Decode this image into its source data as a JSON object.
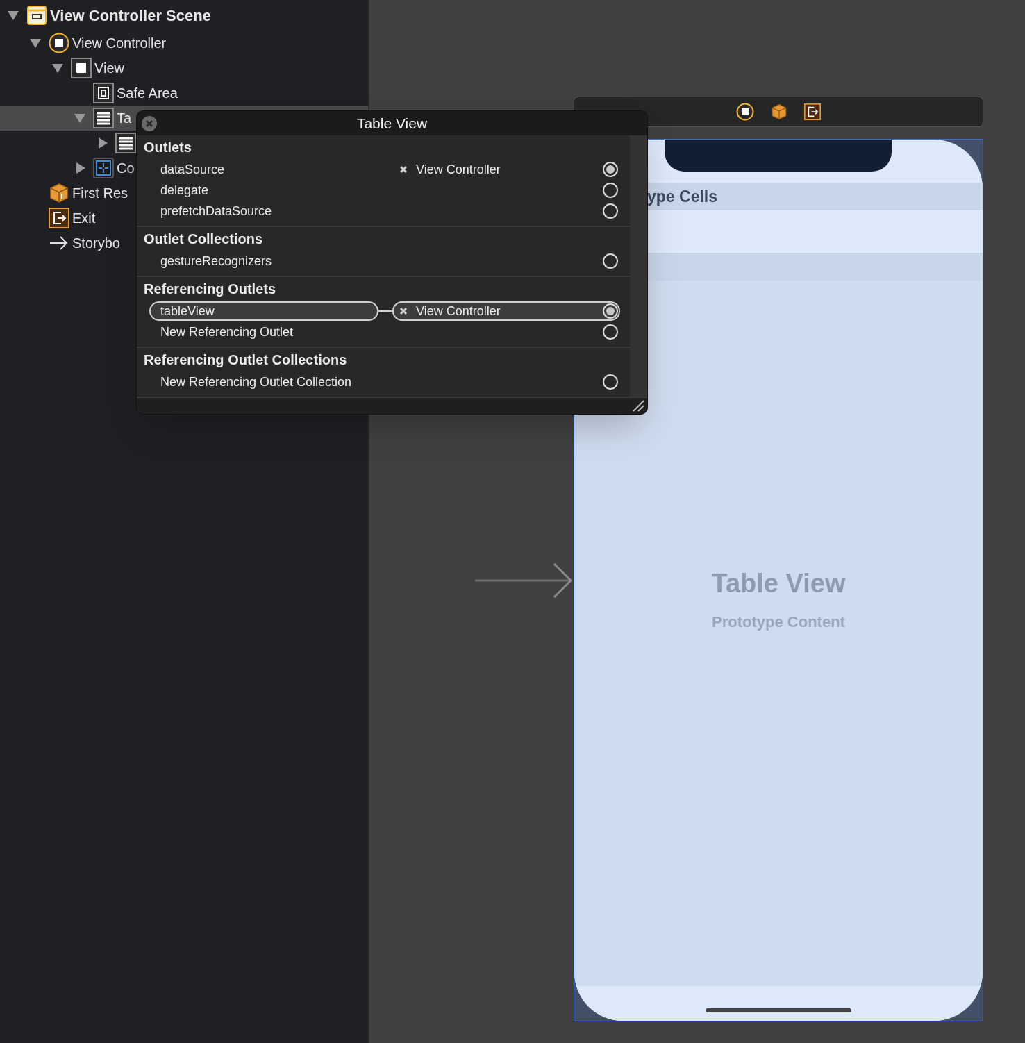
{
  "outline": [
    {
      "label": "View Controller Scene",
      "kind": "scene",
      "expanded": true,
      "selected": false,
      "children": [
        {
          "label": "View Controller",
          "kind": "controller",
          "expanded": true,
          "selected": false,
          "children": [
            {
              "label": "View",
              "kind": "view",
              "expanded": true,
              "selected": false,
              "children": [
                {
                  "label": "Safe Area",
                  "kind": "safe-area",
                  "selected": false
                },
                {
                  "label": "Ta",
                  "kind": "table",
                  "expanded": true,
                  "selected": true,
                  "children": [
                    {
                      "kind": "cell",
                      "expanded": false,
                      "selected": false
                    }
                  ]
                },
                {
                  "label": "Co",
                  "kind": "constraints",
                  "expanded": false,
                  "selected": false
                }
              ]
            }
          ]
        },
        {
          "label": "First Res",
          "kind": "responder",
          "selected": false
        },
        {
          "label": "Exit",
          "kind": "exit",
          "selected": false
        },
        {
          "label": "Storybo",
          "kind": "entry",
          "selected": false
        }
      ]
    }
  ],
  "popover": {
    "title": "Table View",
    "sections": [
      {
        "title": "Outlets",
        "rows": [
          {
            "name": "dataSource",
            "target": "View Controller",
            "connected": true,
            "selected": false
          },
          {
            "name": "delegate",
            "connected": false,
            "selected": false
          },
          {
            "name": "prefetchDataSource",
            "connected": false,
            "selected": false
          }
        ]
      },
      {
        "title": "Outlet Collections",
        "rows": [
          {
            "name": "gestureRecognizers",
            "connected": false,
            "selected": false
          }
        ]
      },
      {
        "title": "Referencing Outlets",
        "rows": [
          {
            "name": "tableView",
            "target": "View Controller",
            "connected": true,
            "selected": true
          },
          {
            "name": "New Referencing Outlet",
            "connected": false,
            "selected": false
          }
        ]
      },
      {
        "title": "Referencing Outlet Collections",
        "rows": [
          {
            "name": "New Referencing Outlet Collection",
            "connected": false,
            "selected": false
          }
        ]
      }
    ]
  },
  "phone": {
    "section_header": "ype Cells",
    "placeholder_title": "Table View",
    "placeholder_subtitle": "Prototype Content"
  }
}
